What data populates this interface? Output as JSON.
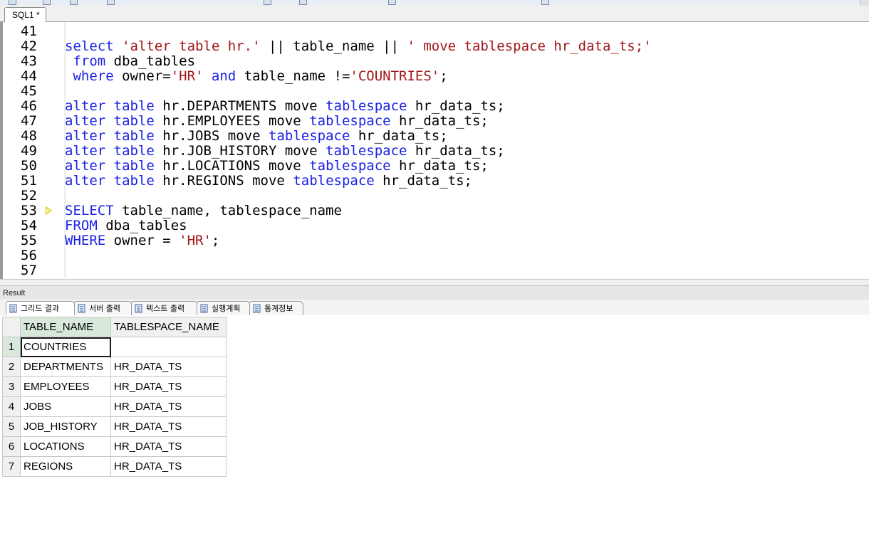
{
  "editor_tab": {
    "label": "SQL1 *"
  },
  "editor": {
    "lines": [
      {
        "num": "41",
        "tokens": []
      },
      {
        "num": "42",
        "tokens": [
          {
            "t": "select ",
            "c": "kw"
          },
          {
            "t": "'alter table hr.'",
            "c": "str"
          },
          {
            "t": " || table_name || ",
            "c": "plain"
          },
          {
            "t": "' move tablespace hr_data_ts;'",
            "c": "str"
          }
        ]
      },
      {
        "num": "43",
        "tokens": [
          {
            "t": " from ",
            "c": "kw"
          },
          {
            "t": "dba_tables",
            "c": "plain"
          }
        ]
      },
      {
        "num": "44",
        "tokens": [
          {
            "t": " where ",
            "c": "kw"
          },
          {
            "t": "owner=",
            "c": "plain"
          },
          {
            "t": "'HR'",
            "c": "str"
          },
          {
            "t": " and ",
            "c": "kw"
          },
          {
            "t": "table_name !=",
            "c": "plain"
          },
          {
            "t": "'COUNTRIES'",
            "c": "str"
          },
          {
            "t": ";",
            "c": "plain"
          }
        ]
      },
      {
        "num": "45",
        "tokens": []
      },
      {
        "num": "46",
        "tokens": [
          {
            "t": "alter table ",
            "c": "kw"
          },
          {
            "t": "hr.DEPARTMENTS move ",
            "c": "plain"
          },
          {
            "t": "tablespace",
            "c": "kw"
          },
          {
            "t": " hr_data_ts;",
            "c": "plain"
          }
        ]
      },
      {
        "num": "47",
        "tokens": [
          {
            "t": "alter table ",
            "c": "kw"
          },
          {
            "t": "hr.EMPLOYEES move ",
            "c": "plain"
          },
          {
            "t": "tablespace",
            "c": "kw"
          },
          {
            "t": " hr_data_ts;",
            "c": "plain"
          }
        ]
      },
      {
        "num": "48",
        "tokens": [
          {
            "t": "alter table ",
            "c": "kw"
          },
          {
            "t": "hr.JOBS move ",
            "c": "plain"
          },
          {
            "t": "tablespace",
            "c": "kw"
          },
          {
            "t": " hr_data_ts;",
            "c": "plain"
          }
        ]
      },
      {
        "num": "49",
        "tokens": [
          {
            "t": "alter table ",
            "c": "kw"
          },
          {
            "t": "hr.JOB_HISTORY move ",
            "c": "plain"
          },
          {
            "t": "tablespace",
            "c": "kw"
          },
          {
            "t": " hr_data_ts;",
            "c": "plain"
          }
        ]
      },
      {
        "num": "50",
        "tokens": [
          {
            "t": "alter table ",
            "c": "kw"
          },
          {
            "t": "hr.LOCATIONS move ",
            "c": "plain"
          },
          {
            "t": "tablespace",
            "c": "kw"
          },
          {
            "t": " hr_data_ts;",
            "c": "plain"
          }
        ]
      },
      {
        "num": "51",
        "tokens": [
          {
            "t": "alter table ",
            "c": "kw"
          },
          {
            "t": "hr.REGIONS move ",
            "c": "plain"
          },
          {
            "t": "tablespace",
            "c": "kw"
          },
          {
            "t": " hr_data_ts;",
            "c": "plain"
          }
        ]
      },
      {
        "num": "52",
        "tokens": []
      },
      {
        "num": "53",
        "tokens": [
          {
            "t": "SELECT ",
            "c": "kw"
          },
          {
            "t": "table_name, tablespace_name",
            "c": "plain"
          }
        ],
        "current": true
      },
      {
        "num": "54",
        "tokens": [
          {
            "t": "FROM ",
            "c": "kw"
          },
          {
            "t": "dba_tables",
            "c": "plain"
          }
        ]
      },
      {
        "num": "55",
        "tokens": [
          {
            "t": "WHERE ",
            "c": "kw"
          },
          {
            "t": "owner = ",
            "c": "plain"
          },
          {
            "t": "'HR'",
            "c": "str"
          },
          {
            "t": ";",
            "c": "plain"
          }
        ]
      },
      {
        "num": "56",
        "tokens": []
      },
      {
        "num": "57",
        "tokens": []
      }
    ]
  },
  "result": {
    "title": "Result",
    "tabs": [
      {
        "label": "그리드 결과",
        "icon": "grid-result-icon"
      },
      {
        "label": "서버 출력",
        "icon": "server-output-icon"
      },
      {
        "label": "텍스트 출력",
        "icon": "text-output-icon"
      },
      {
        "label": "실행계획",
        "icon": "execution-plan-icon"
      },
      {
        "label": "통계정보",
        "icon": "statistics-icon"
      }
    ],
    "grid": {
      "columns": [
        "TABLE_NAME",
        "TABLESPACE_NAME"
      ],
      "rows": [
        {
          "num": "1",
          "cells": [
            "COUNTRIES",
            ""
          ]
        },
        {
          "num": "2",
          "cells": [
            "DEPARTMENTS",
            "HR_DATA_TS"
          ]
        },
        {
          "num": "3",
          "cells": [
            "EMPLOYEES",
            "HR_DATA_TS"
          ]
        },
        {
          "num": "4",
          "cells": [
            "JOBS",
            "HR_DATA_TS"
          ]
        },
        {
          "num": "5",
          "cells": [
            "JOB_HISTORY",
            "HR_DATA_TS"
          ]
        },
        {
          "num": "6",
          "cells": [
            "LOCATIONS",
            "HR_DATA_TS"
          ]
        },
        {
          "num": "7",
          "cells": [
            "REGIONS",
            "HR_DATA_TS"
          ]
        }
      ]
    }
  },
  "colors": {
    "keyword": "#1a22e6",
    "string": "#a31515",
    "selected_header": "#d8e8da"
  }
}
